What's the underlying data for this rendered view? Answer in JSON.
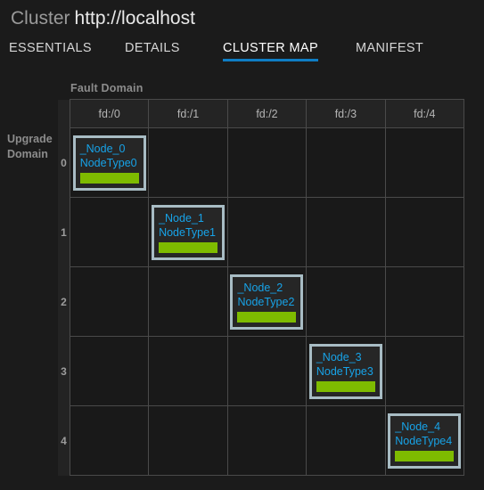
{
  "header": {
    "title": "Cluster",
    "url": "http://localhost"
  },
  "tabs": [
    {
      "id": "essentials",
      "label": "ESSENTIALS",
      "active": false
    },
    {
      "id": "details",
      "label": "DETAILS",
      "active": false
    },
    {
      "id": "clustermap",
      "label": "CLUSTER MAP",
      "active": true
    },
    {
      "id": "manifest",
      "label": "MANIFEST",
      "active": false
    }
  ],
  "grid": {
    "column_axis_label": "Fault Domain",
    "row_axis_label": "Upgrade Domain",
    "column_headers": [
      "fd:/0",
      "fd:/1",
      "fd:/2",
      "fd:/3",
      "fd:/4"
    ],
    "row_headers": [
      "0",
      "1",
      "2",
      "3",
      "4"
    ],
    "nodes": [
      {
        "row": 0,
        "col": 0,
        "name": "_Node_0",
        "type": "NodeType0",
        "health": "healthy"
      },
      {
        "row": 1,
        "col": 1,
        "name": "_Node_1",
        "type": "NodeType1",
        "health": "healthy"
      },
      {
        "row": 2,
        "col": 2,
        "name": "_Node_2",
        "type": "NodeType2",
        "health": "healthy"
      },
      {
        "row": 3,
        "col": 3,
        "name": "_Node_3",
        "type": "NodeType3",
        "health": "healthy"
      },
      {
        "row": 4,
        "col": 4,
        "name": "_Node_4",
        "type": "NodeType4",
        "health": "healthy"
      }
    ]
  },
  "colors": {
    "page_background": "#1b1b1b",
    "accent_tab_underline": "#0f7dc4",
    "node_text": "#17a3e8",
    "node_border": "#a8bcc4",
    "health_ok": "#7ebb00",
    "grid_line": "#4a4a4a",
    "axis_label": "#8c8c8c"
  }
}
